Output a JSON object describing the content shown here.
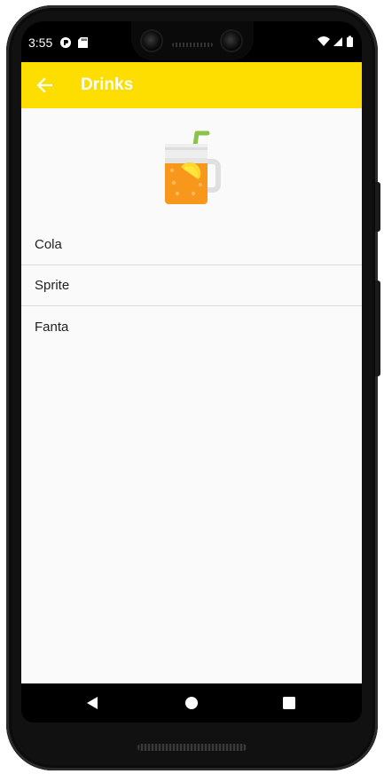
{
  "status_bar": {
    "time": "3:55",
    "left_icons": [
      "notification-app-icon",
      "sd-card-icon"
    ],
    "right_icons": [
      "wifi-icon",
      "cell-signal-icon",
      "battery-icon"
    ]
  },
  "app_bar": {
    "title": "Drinks",
    "background_color": "#fedd00",
    "back_icon": "arrow-back-icon"
  },
  "hero_image": {
    "icon": "juice-jar-icon"
  },
  "drinks": {
    "items": [
      {
        "label": "Cola"
      },
      {
        "label": "Sprite"
      },
      {
        "label": "Fanta"
      }
    ]
  },
  "nav_bar": {
    "back": "nav-back-icon",
    "home": "nav-home-icon",
    "recents": "nav-recents-icon"
  }
}
